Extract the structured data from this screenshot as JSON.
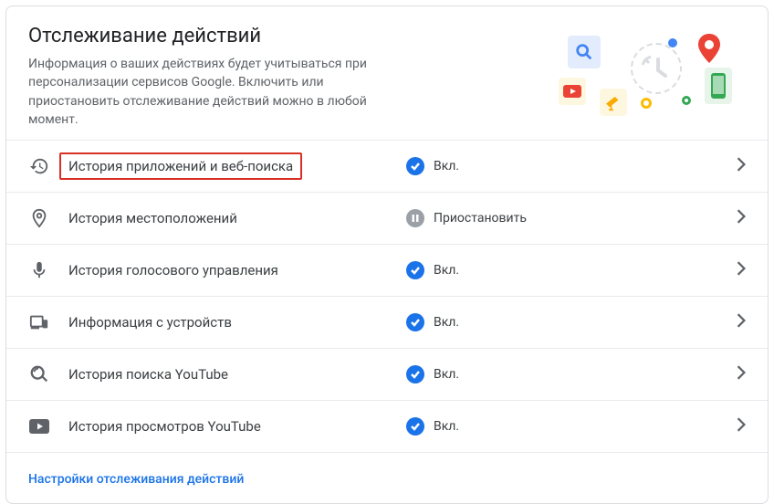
{
  "header": {
    "title": "Отслеживание действий",
    "subtitle": "Информация о ваших действиях будет учитываться при персонализации сервисов Google. Включить или приостановить отслеживание действий можно в любой момент."
  },
  "status_labels": {
    "on": "Вкл.",
    "paused": "Приостановить"
  },
  "items": [
    {
      "icon": "history",
      "label": "История приложений и веб-поиска",
      "status": "on",
      "highlighted": true
    },
    {
      "icon": "location",
      "label": "История местоположений",
      "status": "paused",
      "highlighted": false
    },
    {
      "icon": "mic",
      "label": "История голосового управления",
      "status": "on",
      "highlighted": false
    },
    {
      "icon": "devices",
      "label": "Информация с устройств",
      "status": "on",
      "highlighted": false
    },
    {
      "icon": "search-yt",
      "label": "История поиска YouTube",
      "status": "on",
      "highlighted": false
    },
    {
      "icon": "youtube",
      "label": "История просмотров YouTube",
      "status": "on",
      "highlighted": false
    }
  ],
  "footer": {
    "link": "Настройки отслеживания действий"
  }
}
